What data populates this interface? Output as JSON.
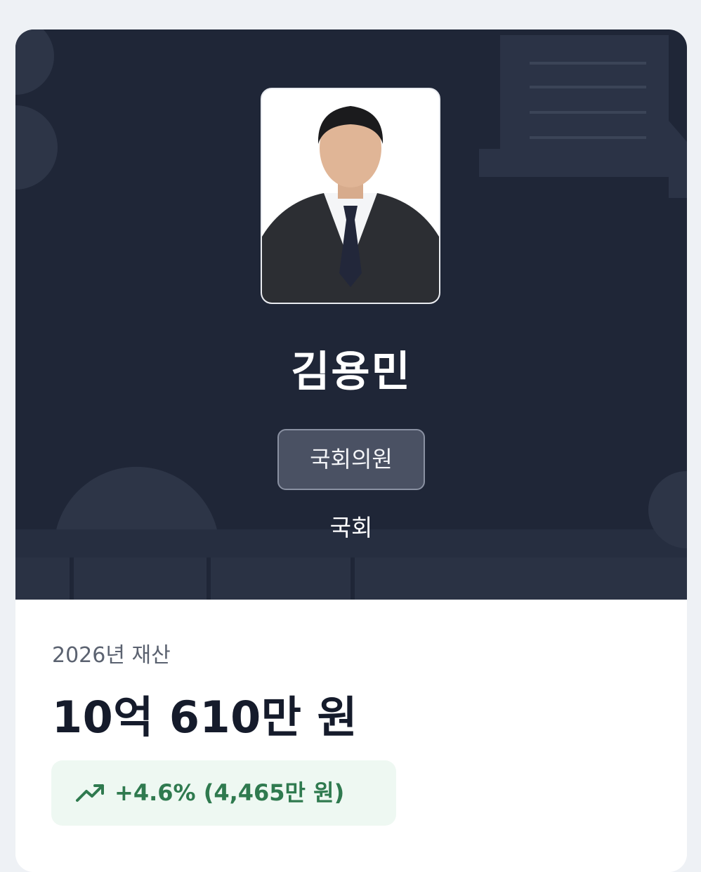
{
  "profile": {
    "name": "김용민",
    "role": "국회의원",
    "organization": "국회"
  },
  "assets": {
    "year_label": "2026년 재산",
    "amount": "10억 610만 원",
    "change": "+4.6% (4,465만 원)"
  },
  "icons": {
    "change": "trending-up-icon",
    "photo": "portrait-photo"
  },
  "colors": {
    "hero_background": "#1f2637",
    "badge_background": "#4a5163",
    "change_positive": "#2f7a4f",
    "change_background": "#eef8f2"
  }
}
